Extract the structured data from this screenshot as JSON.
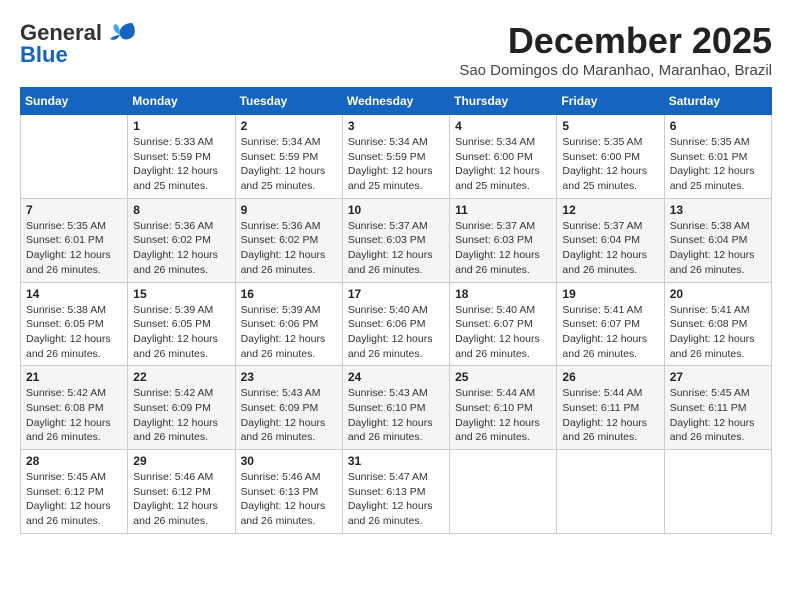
{
  "header": {
    "logo_line1": "General",
    "logo_line2": "Blue",
    "month": "December 2025",
    "location": "Sao Domingos do Maranhao, Maranhao, Brazil"
  },
  "days_of_week": [
    "Sunday",
    "Monday",
    "Tuesday",
    "Wednesday",
    "Thursday",
    "Friday",
    "Saturday"
  ],
  "weeks": [
    [
      {
        "day": "",
        "info": ""
      },
      {
        "day": "1",
        "info": "Sunrise: 5:33 AM\nSunset: 5:59 PM\nDaylight: 12 hours\nand 25 minutes."
      },
      {
        "day": "2",
        "info": "Sunrise: 5:34 AM\nSunset: 5:59 PM\nDaylight: 12 hours\nand 25 minutes."
      },
      {
        "day": "3",
        "info": "Sunrise: 5:34 AM\nSunset: 5:59 PM\nDaylight: 12 hours\nand 25 minutes."
      },
      {
        "day": "4",
        "info": "Sunrise: 5:34 AM\nSunset: 6:00 PM\nDaylight: 12 hours\nand 25 minutes."
      },
      {
        "day": "5",
        "info": "Sunrise: 5:35 AM\nSunset: 6:00 PM\nDaylight: 12 hours\nand 25 minutes."
      },
      {
        "day": "6",
        "info": "Sunrise: 5:35 AM\nSunset: 6:01 PM\nDaylight: 12 hours\nand 25 minutes."
      }
    ],
    [
      {
        "day": "7",
        "info": "Sunrise: 5:35 AM\nSunset: 6:01 PM\nDaylight: 12 hours\nand 26 minutes."
      },
      {
        "day": "8",
        "info": "Sunrise: 5:36 AM\nSunset: 6:02 PM\nDaylight: 12 hours\nand 26 minutes."
      },
      {
        "day": "9",
        "info": "Sunrise: 5:36 AM\nSunset: 6:02 PM\nDaylight: 12 hours\nand 26 minutes."
      },
      {
        "day": "10",
        "info": "Sunrise: 5:37 AM\nSunset: 6:03 PM\nDaylight: 12 hours\nand 26 minutes."
      },
      {
        "day": "11",
        "info": "Sunrise: 5:37 AM\nSunset: 6:03 PM\nDaylight: 12 hours\nand 26 minutes."
      },
      {
        "day": "12",
        "info": "Sunrise: 5:37 AM\nSunset: 6:04 PM\nDaylight: 12 hours\nand 26 minutes."
      },
      {
        "day": "13",
        "info": "Sunrise: 5:38 AM\nSunset: 6:04 PM\nDaylight: 12 hours\nand 26 minutes."
      }
    ],
    [
      {
        "day": "14",
        "info": "Sunrise: 5:38 AM\nSunset: 6:05 PM\nDaylight: 12 hours\nand 26 minutes."
      },
      {
        "day": "15",
        "info": "Sunrise: 5:39 AM\nSunset: 6:05 PM\nDaylight: 12 hours\nand 26 minutes."
      },
      {
        "day": "16",
        "info": "Sunrise: 5:39 AM\nSunset: 6:06 PM\nDaylight: 12 hours\nand 26 minutes."
      },
      {
        "day": "17",
        "info": "Sunrise: 5:40 AM\nSunset: 6:06 PM\nDaylight: 12 hours\nand 26 minutes."
      },
      {
        "day": "18",
        "info": "Sunrise: 5:40 AM\nSunset: 6:07 PM\nDaylight: 12 hours\nand 26 minutes."
      },
      {
        "day": "19",
        "info": "Sunrise: 5:41 AM\nSunset: 6:07 PM\nDaylight: 12 hours\nand 26 minutes."
      },
      {
        "day": "20",
        "info": "Sunrise: 5:41 AM\nSunset: 6:08 PM\nDaylight: 12 hours\nand 26 minutes."
      }
    ],
    [
      {
        "day": "21",
        "info": "Sunrise: 5:42 AM\nSunset: 6:08 PM\nDaylight: 12 hours\nand 26 minutes."
      },
      {
        "day": "22",
        "info": "Sunrise: 5:42 AM\nSunset: 6:09 PM\nDaylight: 12 hours\nand 26 minutes."
      },
      {
        "day": "23",
        "info": "Sunrise: 5:43 AM\nSunset: 6:09 PM\nDaylight: 12 hours\nand 26 minutes."
      },
      {
        "day": "24",
        "info": "Sunrise: 5:43 AM\nSunset: 6:10 PM\nDaylight: 12 hours\nand 26 minutes."
      },
      {
        "day": "25",
        "info": "Sunrise: 5:44 AM\nSunset: 6:10 PM\nDaylight: 12 hours\nand 26 minutes."
      },
      {
        "day": "26",
        "info": "Sunrise: 5:44 AM\nSunset: 6:11 PM\nDaylight: 12 hours\nand 26 minutes."
      },
      {
        "day": "27",
        "info": "Sunrise: 5:45 AM\nSunset: 6:11 PM\nDaylight: 12 hours\nand 26 minutes."
      }
    ],
    [
      {
        "day": "28",
        "info": "Sunrise: 5:45 AM\nSunset: 6:12 PM\nDaylight: 12 hours\nand 26 minutes."
      },
      {
        "day": "29",
        "info": "Sunrise: 5:46 AM\nSunset: 6:12 PM\nDaylight: 12 hours\nand 26 minutes."
      },
      {
        "day": "30",
        "info": "Sunrise: 5:46 AM\nSunset: 6:13 PM\nDaylight: 12 hours\nand 26 minutes."
      },
      {
        "day": "31",
        "info": "Sunrise: 5:47 AM\nSunset: 6:13 PM\nDaylight: 12 hours\nand 26 minutes."
      },
      {
        "day": "",
        "info": ""
      },
      {
        "day": "",
        "info": ""
      },
      {
        "day": "",
        "info": ""
      }
    ]
  ]
}
